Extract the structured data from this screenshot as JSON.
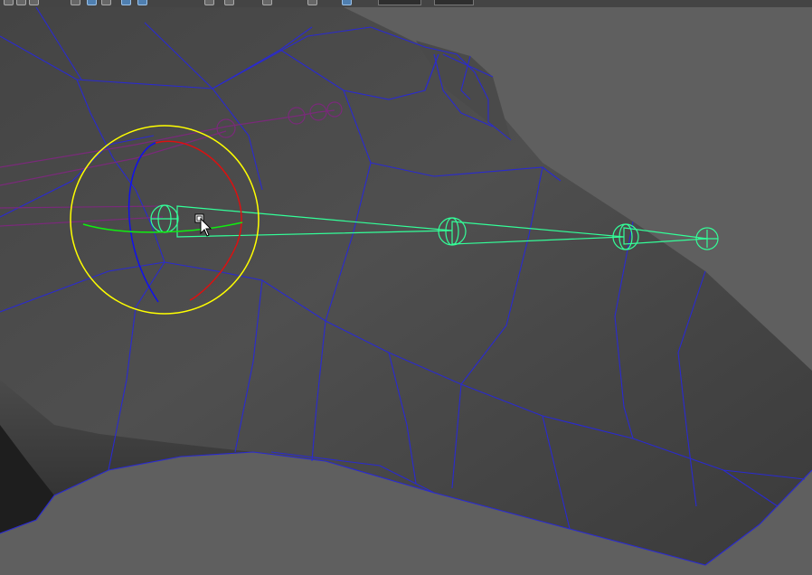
{
  "toolbar": {
    "status_text": "",
    "field_1_value": "",
    "field_2_value": ""
  },
  "viewport": {
    "mesh_color": "#2a2ad0",
    "joint_color": "#33ff99",
    "unselected_joint_color": "#7a2a7a",
    "manipulator_outer_color": "#ffff00",
    "manipulator_x_color": "#dd1010",
    "manipulator_y_color": "#10ee10",
    "manipulator_z_color": "#1010ee"
  }
}
